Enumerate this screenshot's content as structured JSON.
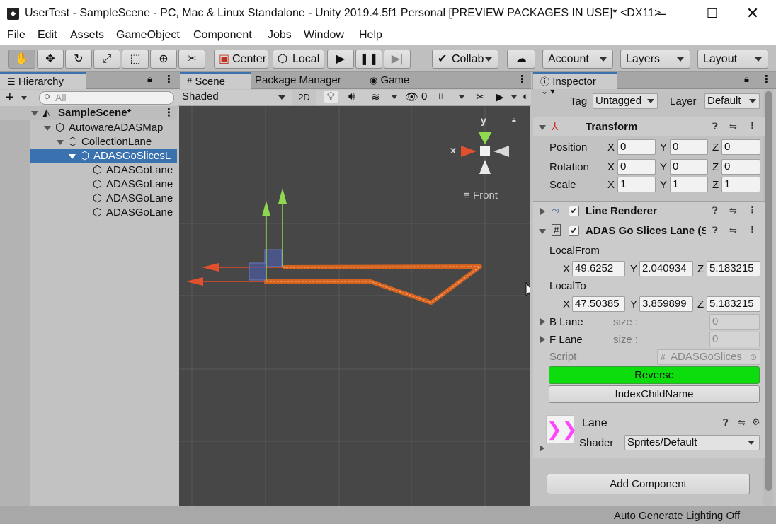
{
  "window": {
    "title": "UserTest - SampleScene - PC, Mac & Linux Standalone - Unity 2019.4.5f1 Personal [PREVIEW PACKAGES IN USE]* <DX11>"
  },
  "menu": [
    "File",
    "Edit",
    "Assets",
    "GameObject",
    "Component",
    "Jobs",
    "Window",
    "Help"
  ],
  "toolbar": {
    "center": "Center",
    "local": "Local",
    "collab": "Collab",
    "account": "Account",
    "layers": "Layers",
    "layout": "Layout"
  },
  "hierarchy": {
    "tab": "Hierarchy",
    "search_placeholder": "All",
    "scene": "SampleScene*",
    "items": [
      "AutowareADASMap",
      "CollectionLane",
      "ADASGoSlicesL",
      "ADASGoLane",
      "ADASGoLane",
      "ADASGoLane",
      "ADASGoLane"
    ]
  },
  "scene_tabs": [
    "Scene",
    "Package Manager",
    "Game"
  ],
  "scene_toolbar": {
    "shading": "Shaded",
    "mode2d": "2D",
    "hidden_count": "0"
  },
  "gizmo": {
    "x": "x",
    "y": "y",
    "view": "Front"
  },
  "inspector": {
    "tab": "Inspector",
    "tag_label": "Tag",
    "tag_value": "Untagged",
    "layer_label": "Layer",
    "layer_value": "Default",
    "transform": {
      "name": "Transform",
      "position_label": "Position",
      "rotation_label": "Rotation",
      "scale_label": "Scale",
      "position": [
        "0",
        "0",
        "0"
      ],
      "rotation": [
        "0",
        "0",
        "0"
      ],
      "scale": [
        "1",
        "1",
        "1"
      ]
    },
    "line_renderer": "Line Renderer",
    "slices": {
      "name": "ADAS Go Slices Lane (S",
      "local_from_label": "LocalFrom",
      "local_from": [
        "49.6252",
        "2.040934",
        "5.183215"
      ],
      "local_to_label": "LocalTo",
      "local_to": [
        "47.50385",
        "3.859899",
        "5.183215"
      ],
      "b_lane": "B Lane",
      "f_lane": "F Lane",
      "size_label": "size :",
      "b_size": "0",
      "f_size": "0",
      "script_label": "Script",
      "script_value": "ADASGoSlices",
      "reverse": "Reverse",
      "index": "IndexChildName"
    },
    "material": {
      "name": "Lane",
      "shader_label": "Shader",
      "shader_value": "Sprites/Default"
    },
    "add_component": "Add Component",
    "axis_labels": [
      "X",
      "Y",
      "Z"
    ]
  },
  "status": "Auto Generate Lighting Off",
  "colors": {
    "selection": "#3a72b0",
    "reverse_button": "#0ddc0d",
    "lane_line": "#e8661e",
    "scene_bg": "#474747"
  }
}
